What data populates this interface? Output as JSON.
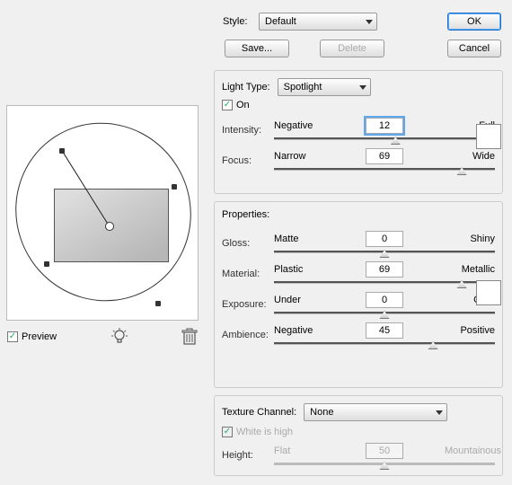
{
  "style": {
    "label": "Style:",
    "value": "Default",
    "save": "Save...",
    "delete": "Delete"
  },
  "buttons": {
    "ok": "OK",
    "cancel": "Cancel"
  },
  "light": {
    "group": "Light Type:",
    "type": "Spotlight",
    "on": "On",
    "intensity": {
      "label": "Intensity:",
      "min": "Negative",
      "max": "Full",
      "value": "12",
      "pct": 55
    },
    "focus": {
      "label": "Focus:",
      "min": "Narrow",
      "max": "Wide",
      "value": "69",
      "pct": 85
    }
  },
  "props": {
    "group": "Properties:",
    "gloss": {
      "label": "Gloss:",
      "min": "Matte",
      "max": "Shiny",
      "value": "0",
      "pct": 50
    },
    "material": {
      "label": "Material:",
      "min": "Plastic",
      "max": "Metallic",
      "value": "69",
      "pct": 85
    },
    "exposure": {
      "label": "Exposure:",
      "min": "Under",
      "max": "Over",
      "value": "0",
      "pct": 50
    },
    "ambience": {
      "label": "Ambience:",
      "min": "Negative",
      "max": "Positive",
      "value": "45",
      "pct": 72
    }
  },
  "texture": {
    "group": "Texture Channel:",
    "value": "None",
    "white": "White is high",
    "height": {
      "label": "Height:",
      "min": "Flat",
      "max": "Mountainous",
      "value": "50",
      "pct": 50
    }
  },
  "preview": {
    "label": "Preview"
  },
  "icons": {
    "bulb": "lightbulb-icon",
    "trash": "trash-icon"
  }
}
